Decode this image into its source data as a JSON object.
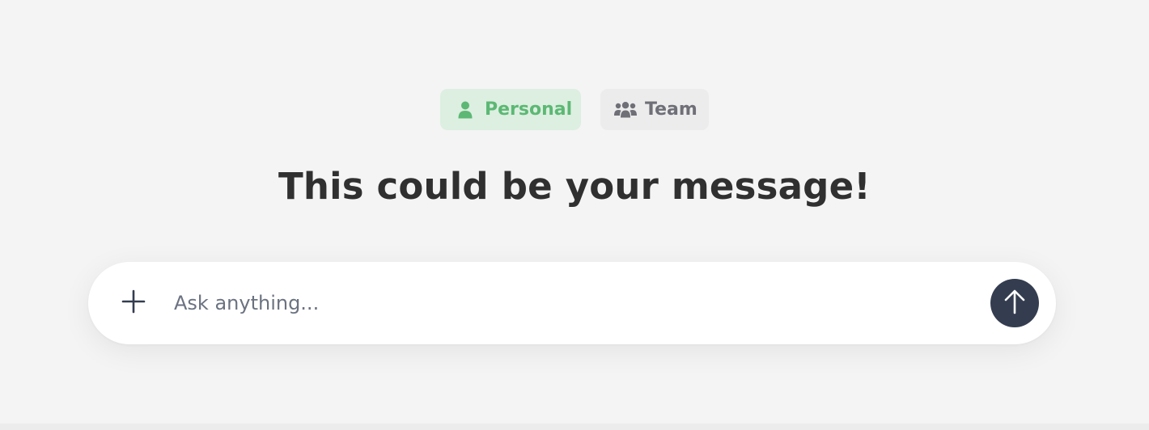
{
  "mode_toggle": {
    "personal": {
      "label": "Personal",
      "icon": "user-icon",
      "active": true,
      "color": "#5cb874",
      "background": "#dcefe0"
    },
    "team": {
      "label": "Team",
      "icon": "users-icon",
      "active": false,
      "color": "#6f6f78",
      "background": "#ececec"
    }
  },
  "headline": "This could be your message!",
  "composer": {
    "add_icon": "plus-icon",
    "placeholder": "Ask anything...",
    "value": "",
    "send_icon": "arrow-up-icon",
    "send_color": "#343d50"
  },
  "colors": {
    "page_background": "#f4f4f4",
    "headline_text": "#303030"
  }
}
